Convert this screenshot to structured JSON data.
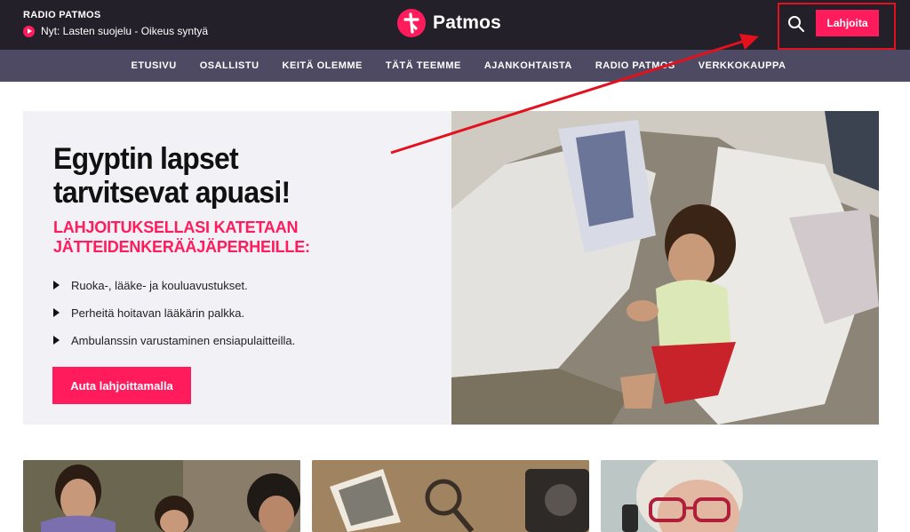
{
  "header": {
    "radio_title": "RADIO PATMOS",
    "now_playing": "Nyt: Lasten suojelu - Oikeus syntyä",
    "logo_text": "Patmos",
    "donate_label": "Lahjoita"
  },
  "nav": {
    "items": [
      "ETUSIVU",
      "OSALLISTU",
      "KEITÄ OLEMME",
      "TÄTÄ TEEMME",
      "AJANKOHTAISTA",
      "RADIO PATMOS",
      "VERKKOKAUPPA"
    ]
  },
  "hero": {
    "title": "Egyptin lapset tarvitsevat apuasi!",
    "subtitle": "LAHJOITUKSELLASI KATETAAN JÄTTEIDENKERÄÄJÄPERHEILLE:",
    "bullets": [
      "Ruoka-, lääke- ja kouluavustukset.",
      "Perheitä hoitavan lääkärin palkka.",
      "Ambulanssin varustaminen ensiapulaitteilla."
    ],
    "cta_label": "Auta lahjoittamalla"
  },
  "colors": {
    "brand_pink": "#ff1b5c",
    "topbar_bg": "#23202a",
    "nav_bg": "#4f4a63",
    "hero_panel_bg": "#f2f2f6",
    "annotation_red": "#e3101e"
  },
  "icons": {
    "search": "search-icon",
    "play": "play-icon",
    "logo": "patmos-cross-logo-icon"
  }
}
